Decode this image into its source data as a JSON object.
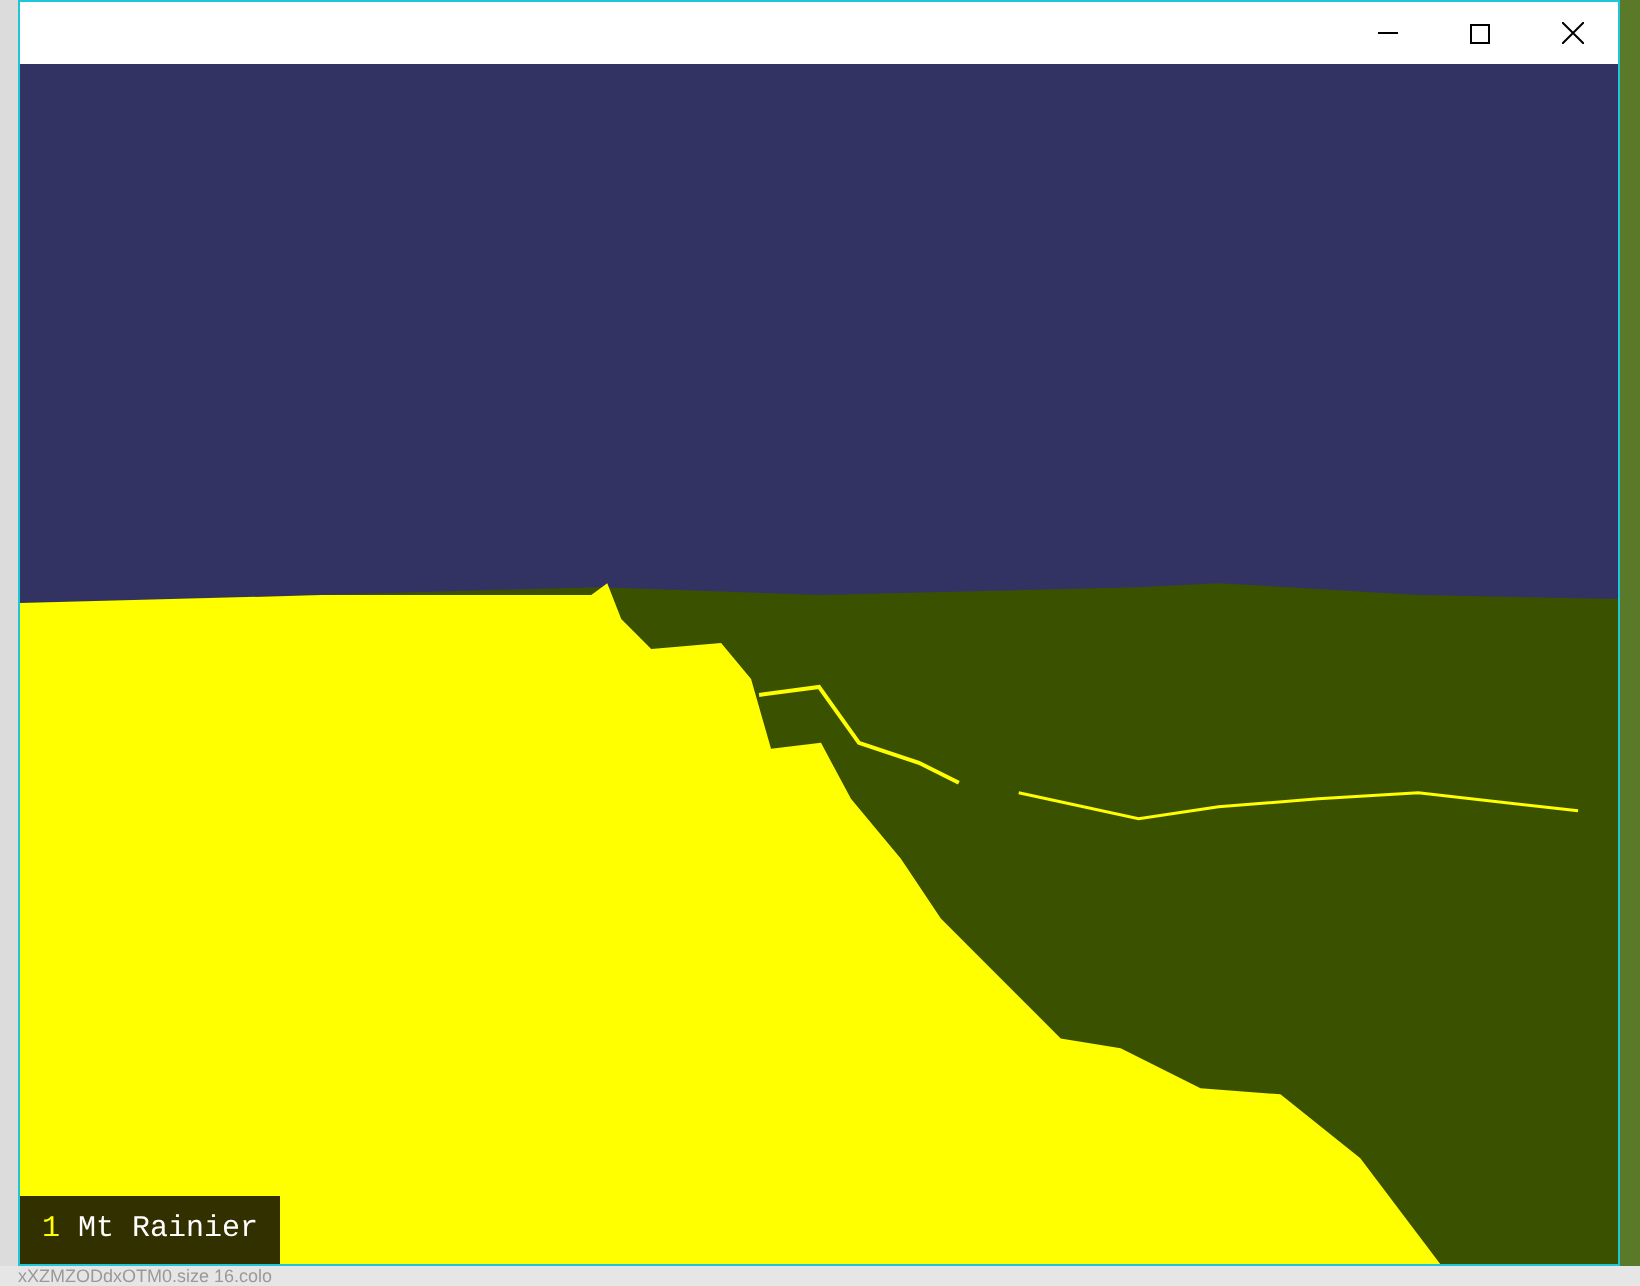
{
  "scene": {
    "label_number": "1",
    "label_name": "Mt Rainier"
  },
  "desktop": {
    "partial_text": "xXZMZODdxOTM0.size  16.colo"
  }
}
